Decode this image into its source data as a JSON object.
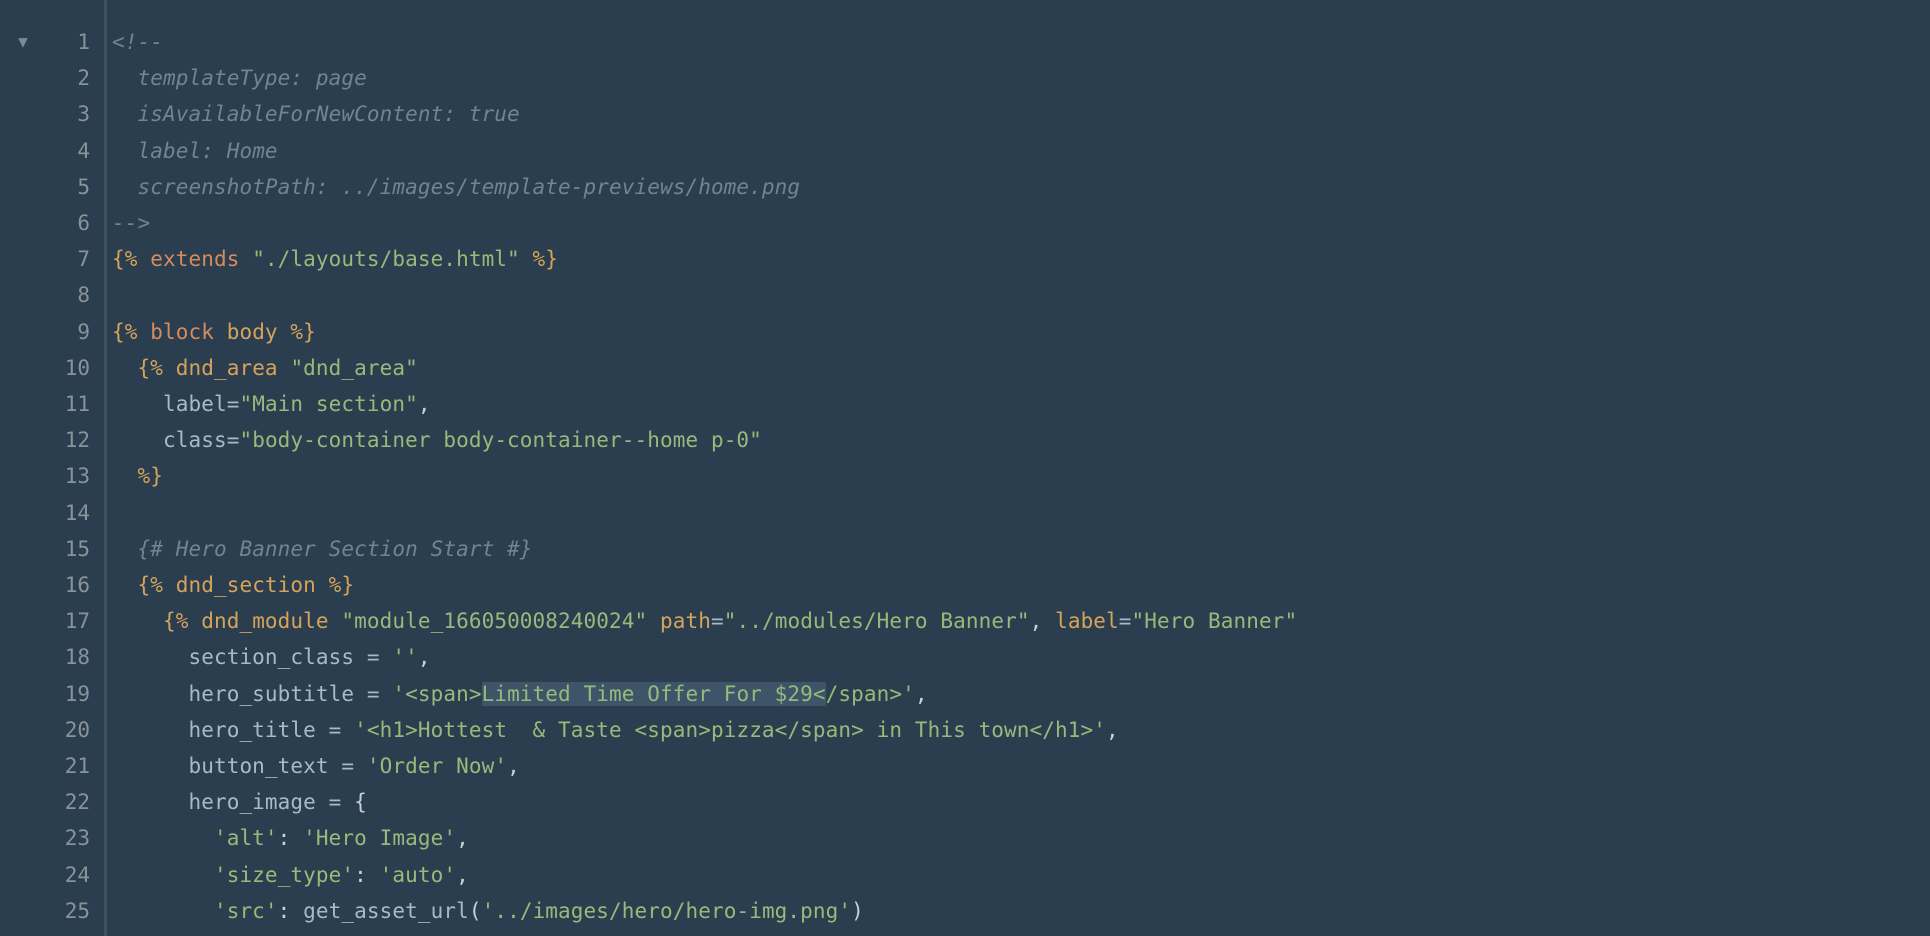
{
  "fold_marker": "▼",
  "gutter": {
    "start": 1,
    "end": 25
  },
  "code": {
    "lines": [
      {
        "indent": 0,
        "tokens": [
          {
            "cls": "tok-comment",
            "t": "<!--"
          }
        ]
      },
      {
        "indent": 1,
        "tokens": [
          {
            "cls": "tok-comment",
            "t": "templateType: page"
          }
        ]
      },
      {
        "indent": 1,
        "tokens": [
          {
            "cls": "tok-comment",
            "t": "isAvailableForNewContent: true"
          }
        ]
      },
      {
        "indent": 1,
        "tokens": [
          {
            "cls": "tok-comment",
            "t": "label: Home"
          }
        ]
      },
      {
        "indent": 1,
        "tokens": [
          {
            "cls": "tok-comment",
            "t": "screenshotPath: ../images/template-previews/home.png"
          }
        ]
      },
      {
        "indent": 0,
        "tokens": [
          {
            "cls": "tok-comment",
            "t": "-->"
          }
        ]
      },
      {
        "indent": 0,
        "tokens": [
          {
            "cls": "tok-tag",
            "t": "{% "
          },
          {
            "cls": "tok-keyword",
            "t": "extends"
          },
          {
            "cls": "tok-plain",
            "t": " "
          },
          {
            "cls": "tok-string",
            "t": "\"./layouts/base.html\""
          },
          {
            "cls": "tok-tag",
            "t": " %}"
          }
        ]
      },
      {
        "indent": 0,
        "tokens": []
      },
      {
        "indent": 0,
        "tokens": [
          {
            "cls": "tok-tag",
            "t": "{% "
          },
          {
            "cls": "tok-keyword",
            "t": "block"
          },
          {
            "cls": "tok-plain",
            "t": " "
          },
          {
            "cls": "tok-name",
            "t": "body"
          },
          {
            "cls": "tok-tag",
            "t": " %}"
          }
        ]
      },
      {
        "indent": 1,
        "tokens": [
          {
            "cls": "tok-tag",
            "t": "{% "
          },
          {
            "cls": "tok-name",
            "t": "dnd_area"
          },
          {
            "cls": "tok-plain",
            "t": " "
          },
          {
            "cls": "tok-string",
            "t": "\"dnd_area\""
          }
        ]
      },
      {
        "indent": 2,
        "tokens": [
          {
            "cls": "tok-attrname",
            "t": "label"
          },
          {
            "cls": "tok-eq",
            "t": "="
          },
          {
            "cls": "tok-string",
            "t": "\"Main section\""
          },
          {
            "cls": "tok-plain",
            "t": ","
          }
        ]
      },
      {
        "indent": 2,
        "tokens": [
          {
            "cls": "tok-attrname",
            "t": "class"
          },
          {
            "cls": "tok-eq",
            "t": "="
          },
          {
            "cls": "tok-string",
            "t": "\"body-container body-container--home p-0\""
          }
        ]
      },
      {
        "indent": 1,
        "tokens": [
          {
            "cls": "tok-tag",
            "t": "%}"
          }
        ]
      },
      {
        "indent": 0,
        "tokens": []
      },
      {
        "indent": 1,
        "tokens": [
          {
            "cls": "tok-comment",
            "t": "{# Hero Banner Section Start #}"
          }
        ]
      },
      {
        "indent": 1,
        "tokens": [
          {
            "cls": "tok-tag",
            "t": "{% "
          },
          {
            "cls": "tok-name",
            "t": "dnd_section"
          },
          {
            "cls": "tok-tag",
            "t": " %}"
          }
        ]
      },
      {
        "indent": 2,
        "tokens": [
          {
            "cls": "tok-tag",
            "t": "{% "
          },
          {
            "cls": "tok-name",
            "t": "dnd_module"
          },
          {
            "cls": "tok-plain",
            "t": " "
          },
          {
            "cls": "tok-string",
            "t": "\"module_166050008240024\""
          },
          {
            "cls": "tok-plain",
            "t": " "
          },
          {
            "cls": "tok-attr",
            "t": "path"
          },
          {
            "cls": "tok-eq",
            "t": "="
          },
          {
            "cls": "tok-string",
            "t": "\"../modules/Hero Banner\""
          },
          {
            "cls": "tok-plain",
            "t": ", "
          },
          {
            "cls": "tok-attr",
            "t": "label"
          },
          {
            "cls": "tok-eq",
            "t": "="
          },
          {
            "cls": "tok-string",
            "t": "\"Hero Banner\""
          }
        ]
      },
      {
        "indent": 3,
        "tokens": [
          {
            "cls": "tok-attrname",
            "t": "section_class "
          },
          {
            "cls": "tok-eq",
            "t": "= "
          },
          {
            "cls": "tok-string",
            "t": "''"
          },
          {
            "cls": "tok-plain",
            "t": ","
          }
        ]
      },
      {
        "indent": 3,
        "tokens": [
          {
            "cls": "tok-attrname",
            "t": "hero_subtitle "
          },
          {
            "cls": "tok-eq",
            "t": "= "
          },
          {
            "cls": "tok-string",
            "t": "'<span>"
          },
          {
            "cls": "tok-string tok-selected",
            "t": "Limited Time Offer For $29<"
          },
          {
            "cls": "tok-string",
            "t": "/span>'"
          },
          {
            "cls": "tok-plain",
            "t": ","
          }
        ]
      },
      {
        "indent": 3,
        "tokens": [
          {
            "cls": "tok-attrname",
            "t": "hero_title "
          },
          {
            "cls": "tok-eq",
            "t": "= "
          },
          {
            "cls": "tok-string",
            "t": "'<h1>Hottest  & Taste <span>pizza</span> in This town</h1>'"
          },
          {
            "cls": "tok-plain",
            "t": ","
          }
        ]
      },
      {
        "indent": 3,
        "tokens": [
          {
            "cls": "tok-attrname",
            "t": "button_text "
          },
          {
            "cls": "tok-eq",
            "t": "= "
          },
          {
            "cls": "tok-string",
            "t": "'Order Now'"
          },
          {
            "cls": "tok-plain",
            "t": ","
          }
        ]
      },
      {
        "indent": 3,
        "tokens": [
          {
            "cls": "tok-attrname",
            "t": "hero_image "
          },
          {
            "cls": "tok-eq",
            "t": "= "
          },
          {
            "cls": "tok-brace",
            "t": "{"
          }
        ]
      },
      {
        "indent": 4,
        "tokens": [
          {
            "cls": "tok-string",
            "t": "'alt'"
          },
          {
            "cls": "tok-plain",
            "t": ": "
          },
          {
            "cls": "tok-string",
            "t": "'Hero Image'"
          },
          {
            "cls": "tok-plain",
            "t": ","
          }
        ]
      },
      {
        "indent": 4,
        "tokens": [
          {
            "cls": "tok-string",
            "t": "'size_type'"
          },
          {
            "cls": "tok-plain",
            "t": ": "
          },
          {
            "cls": "tok-string",
            "t": "'auto'"
          },
          {
            "cls": "tok-plain",
            "t": ","
          }
        ]
      },
      {
        "indent": 4,
        "tokens": [
          {
            "cls": "tok-string",
            "t": "'src'"
          },
          {
            "cls": "tok-plain",
            "t": ": "
          },
          {
            "cls": "tok-func",
            "t": "get_asset_url"
          },
          {
            "cls": "tok-plain",
            "t": "("
          },
          {
            "cls": "tok-string",
            "t": "'../images/hero/hero-img.png'"
          },
          {
            "cls": "tok-plain",
            "t": ")"
          }
        ]
      }
    ]
  }
}
